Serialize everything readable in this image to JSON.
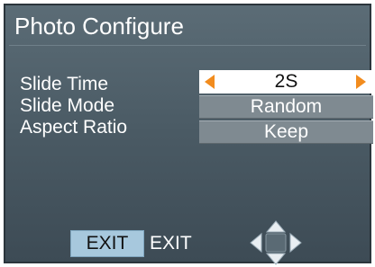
{
  "header": {
    "title": "Photo Configure"
  },
  "settings": [
    {
      "label": "Slide Time",
      "value": "2S"
    },
    {
      "label": "Slide Mode",
      "value": "Random"
    },
    {
      "label": "Aspect Ratio",
      "value": "Keep"
    }
  ],
  "footer": {
    "exit_button_label": "EXIT",
    "exit_text": "EXIT"
  },
  "icons": {
    "left": "caret-left-icon",
    "right": "caret-right-icon",
    "dpad": "directional-pad-icon"
  },
  "colors": {
    "panel_bg": "#4a5a64",
    "selected_bg": "#ffffff",
    "row_bg": "#7f8a91",
    "arrow": "#f28c1e",
    "exit_button_bg": "#a7c8dd",
    "dpad_fill": "#e9eef2"
  }
}
